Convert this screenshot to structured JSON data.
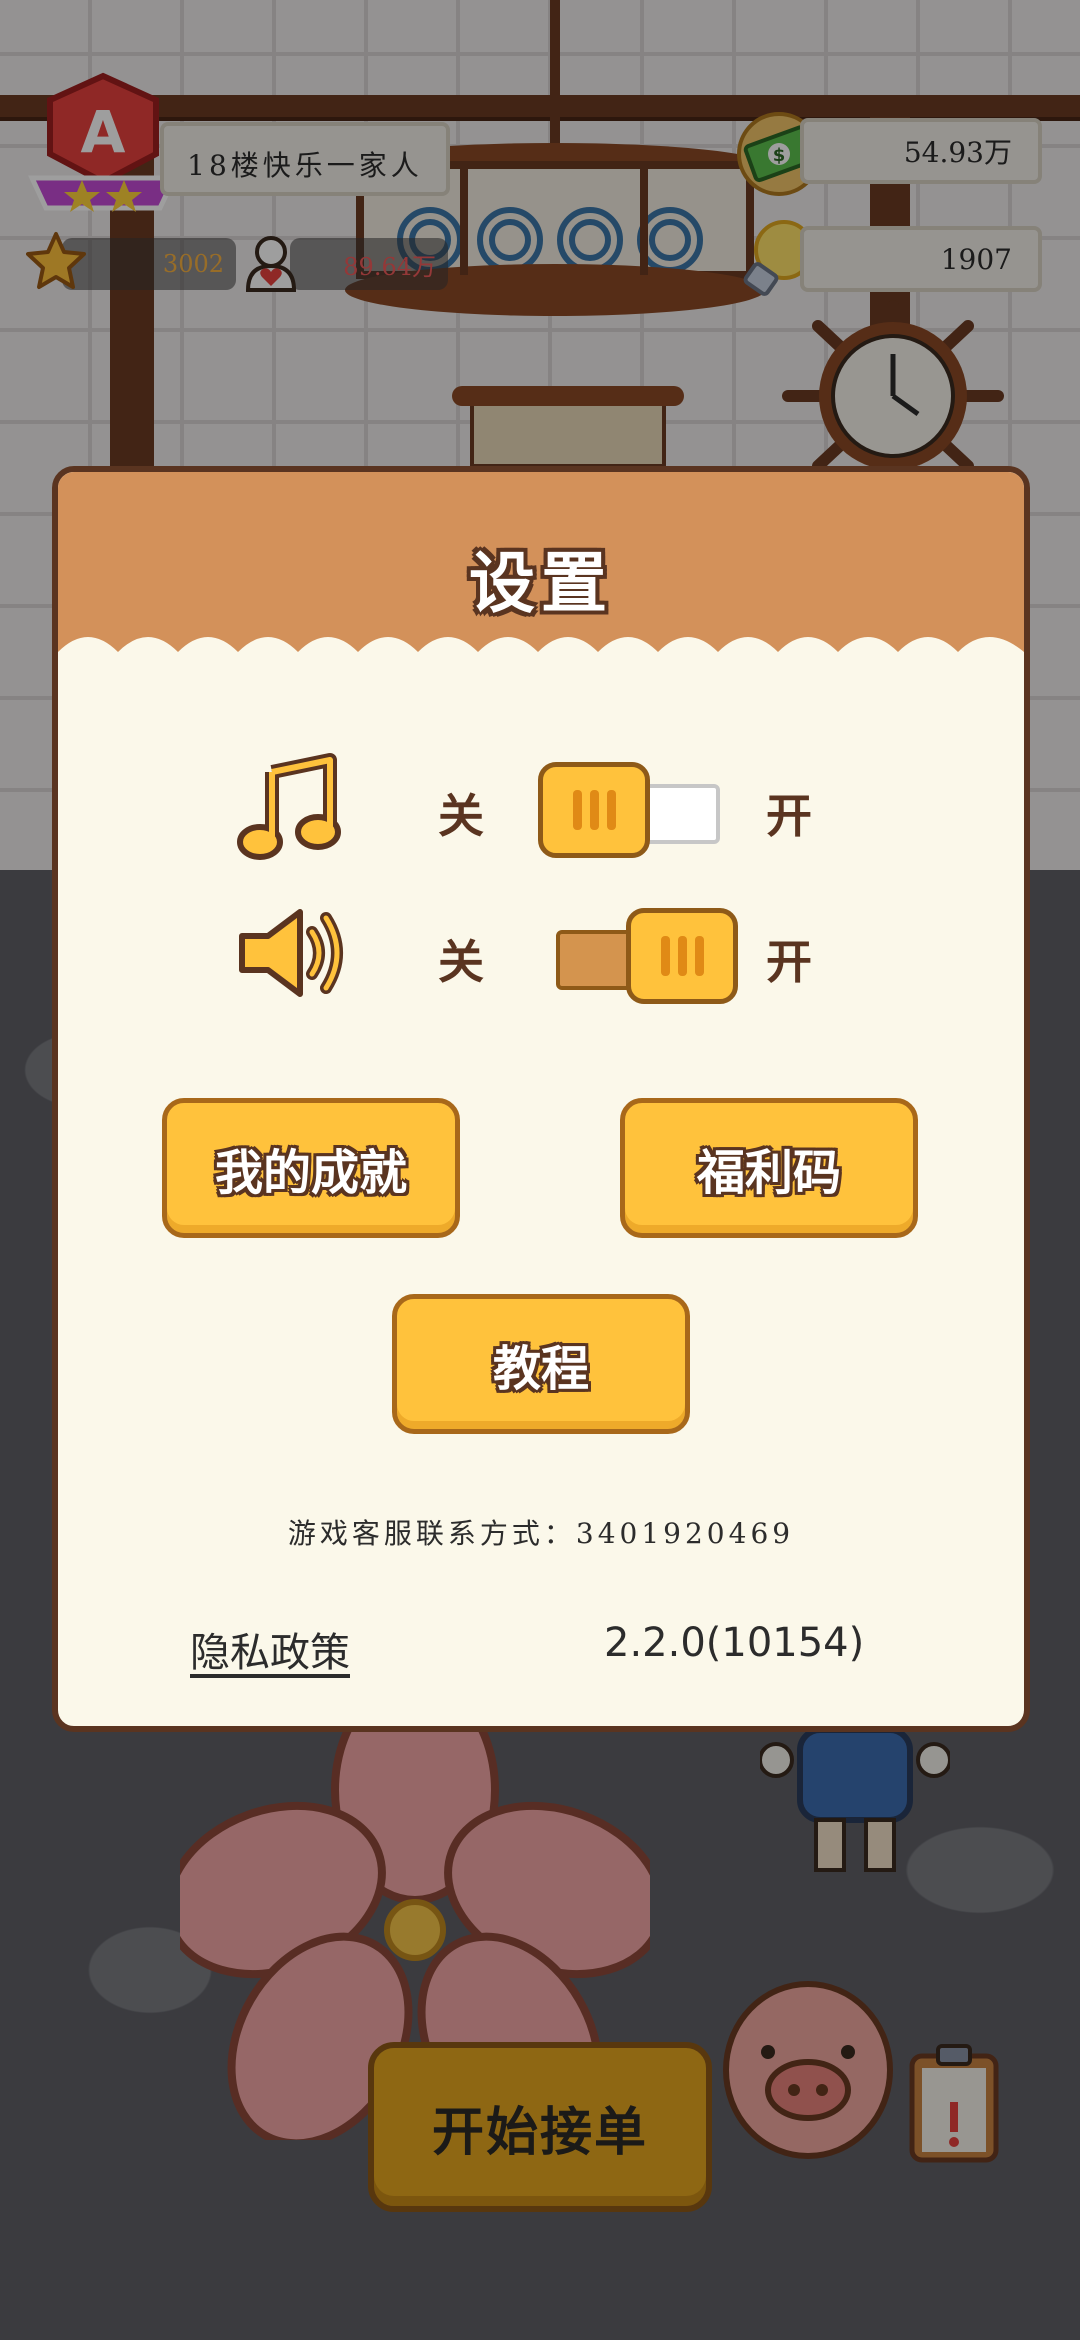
{
  "hud": {
    "rank_letter": "A",
    "shop_name": "18楼快乐一家人",
    "stars": "3002",
    "fans": "89.64万",
    "money": "54.93万",
    "ideas": "1907"
  },
  "dialog": {
    "title": "设置",
    "music": {
      "off_label": "关",
      "on_label": "开",
      "state": "off"
    },
    "sound": {
      "off_label": "关",
      "on_label": "开",
      "state": "on"
    },
    "buttons": {
      "achievements": "我的成就",
      "gift_code": "福利码",
      "tutorial": "教程"
    },
    "contact": "游戏客服联系方式：3401920469",
    "privacy": "隐私政策",
    "version": "2.2.0(10154)"
  },
  "bottom": {
    "start_button": "开始接单"
  },
  "colors": {
    "accent": "#ffc23c",
    "header": "#d3915a",
    "border": "#5a3420",
    "panel": "#fbf8ea"
  }
}
